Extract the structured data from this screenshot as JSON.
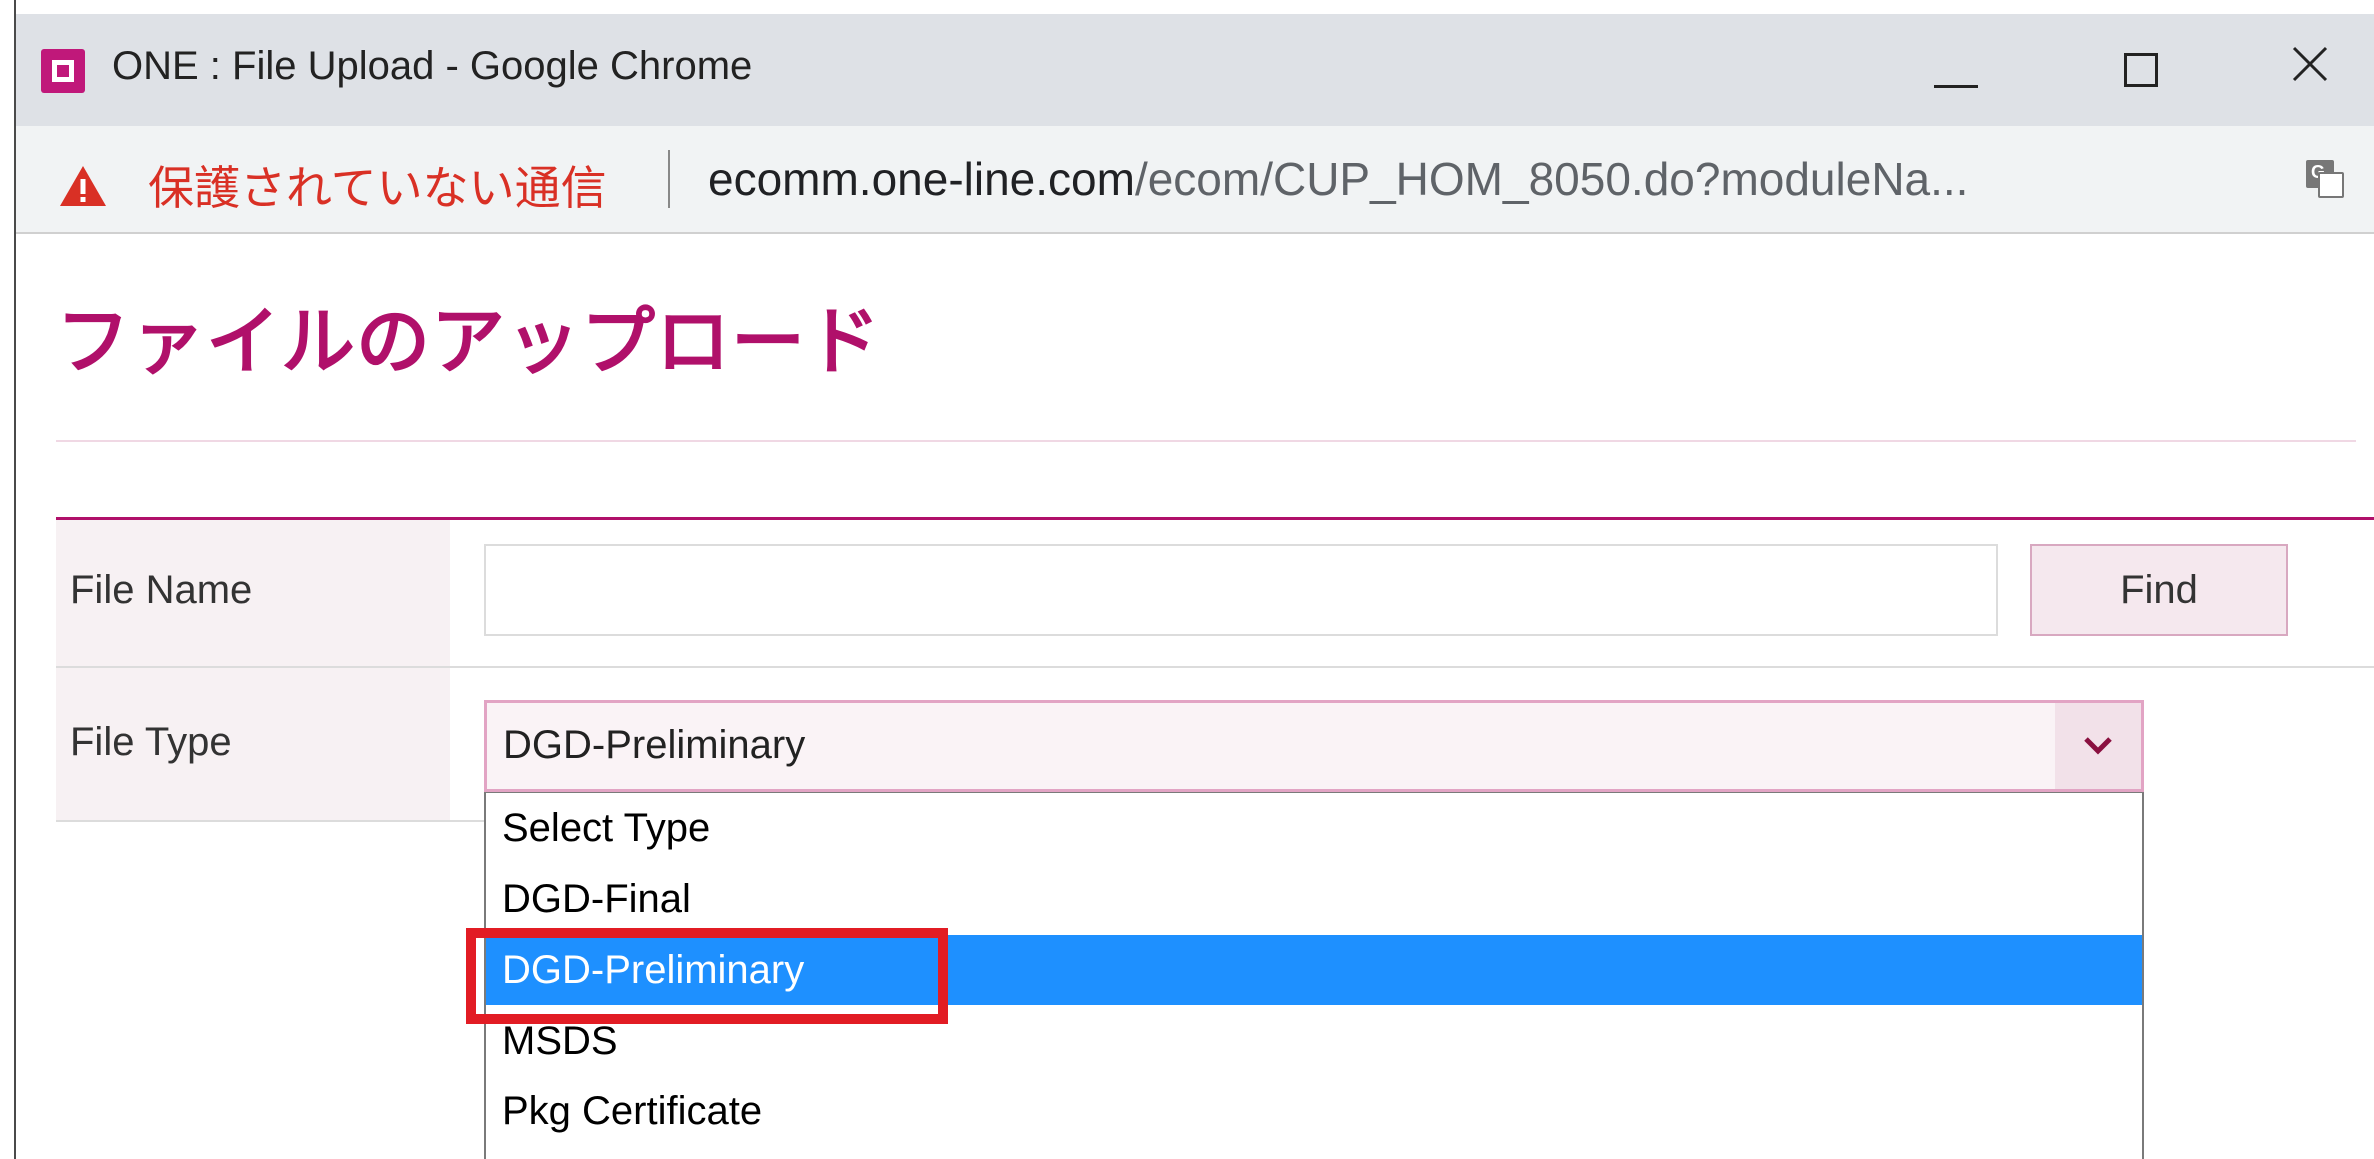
{
  "window": {
    "title": "ONE : File Upload - Google Chrome"
  },
  "address_bar": {
    "security_text": "保護されていない通信",
    "url_host": "ecomm.one-line.com",
    "url_path": "/ecom/CUP_HOM_8050.do?moduleNa..."
  },
  "page": {
    "heading": "ファイルのアップロード"
  },
  "form": {
    "file_name_label": "File Name",
    "file_name_value": "",
    "find_button_label": "Find",
    "file_type_label": "File Type",
    "file_type_selected": "DGD-Preliminary",
    "options": [
      "Select Type",
      "DGD-Final",
      "DGD-Preliminary",
      "MSDS",
      "Pkg Certificate"
    ],
    "highlighted_option": "DGD-Preliminary"
  },
  "colors": {
    "brand": "#b0106a",
    "selection": "#1e90ff",
    "annotation": "#e21c24",
    "warning": "#d93025"
  },
  "icons": {
    "app": "one-app-icon",
    "warning": "warning-triangle-icon",
    "translate": "translate-icon",
    "dropdown": "chevron-down-icon"
  }
}
